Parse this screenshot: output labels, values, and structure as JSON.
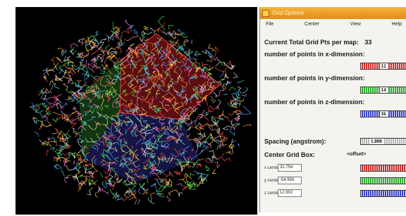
{
  "window": {
    "title": "Grid Options"
  },
  "menu": [
    "File",
    "Center",
    "View",
    "Help"
  ],
  "total": {
    "label": "Current Total Grid Pts per map:",
    "value": "33"
  },
  "dims": [
    {
      "label": "number of points in x-dimension:",
      "value": "12",
      "color": "#d13030"
    },
    {
      "label": "number of points in y-dimension:",
      "value": "14",
      "color": "#2fae2f"
    },
    {
      "label": "number of points in z-dimension:",
      "value": "16",
      "color": "#3b45c9"
    }
  ],
  "spacing": {
    "label": "Spacing (angstrom):",
    "value": "1.000"
  },
  "center": {
    "label": "Center Grid Box:",
    "offset_label": "<offset>",
    "coords": [
      {
        "label": "x center:",
        "value": "32.754",
        "color": "#d13030"
      },
      {
        "label": "y center:",
        "value": "-54.956",
        "color": "#2fae2f"
      },
      {
        "label": "z center:",
        "value": "12.902",
        "color": "#3b45c9"
      }
    ]
  }
}
